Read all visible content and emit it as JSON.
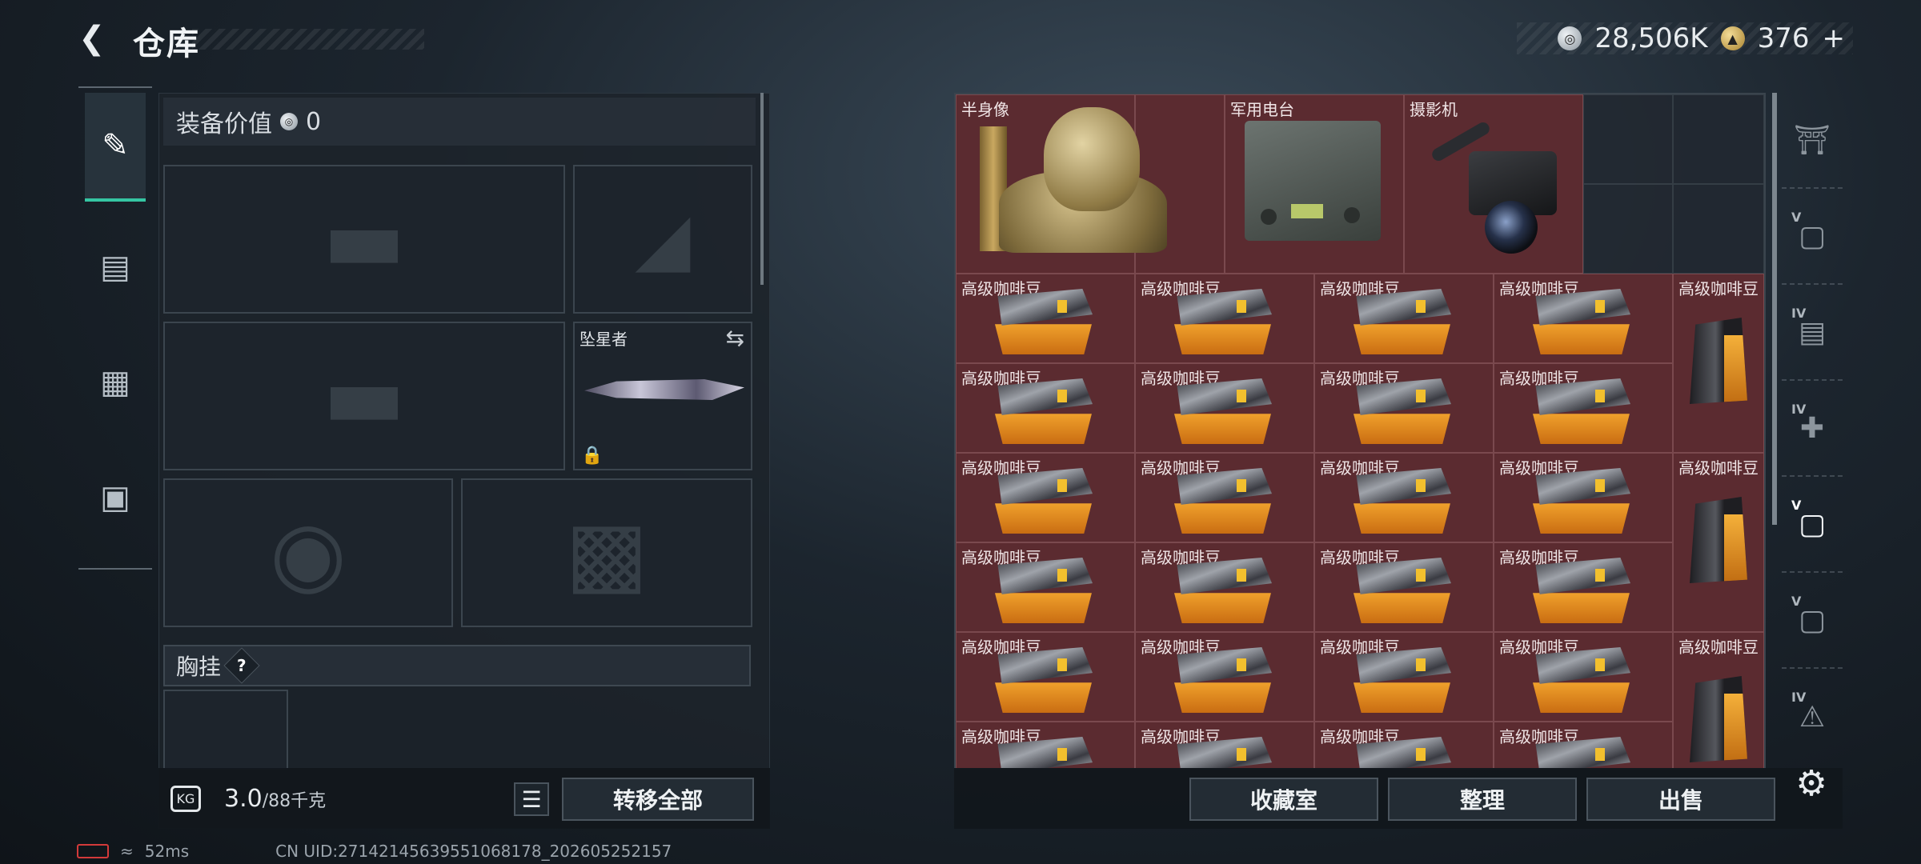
{
  "header": {
    "title": "仓库",
    "back_icon": "back-arrow-icon"
  },
  "currency": {
    "silver_value": "28,506K",
    "gold_value": "376",
    "gold_add": "+"
  },
  "loadout": {
    "value_label": "装备价值",
    "value_amount": "0",
    "melee_name": "坠星者",
    "chest_label": "胸挂",
    "help_glyph": "?",
    "weight_current": "3.0",
    "weight_max": "/88千克",
    "weight_icon_text": "KG",
    "transfer_all": "转移全部"
  },
  "side_tabs": [
    {
      "name": "weapons",
      "icon": "pistol-icon"
    },
    {
      "name": "backpack",
      "icon": "backpack-icon"
    },
    {
      "name": "vest",
      "icon": "vest-icon"
    },
    {
      "name": "toolbox",
      "icon": "briefcase-icon"
    }
  ],
  "storage": {
    "top_items": [
      {
        "label": "半身像"
      },
      {
        "label": "军用电台"
      },
      {
        "label": "摄影机"
      }
    ],
    "coffee_label": "高级咖啡豆"
  },
  "category_tabs": [
    {
      "icon": "safe-house-icon",
      "level": ""
    },
    {
      "icon": "camera-workbench-icon",
      "level": "V"
    },
    {
      "icon": "folder-icon",
      "level": "IV"
    },
    {
      "icon": "medical-bench-icon",
      "level": "IV"
    },
    {
      "icon": "camera-workbench-icon",
      "level": "V"
    },
    {
      "icon": "camera-workbench-icon",
      "level": "V"
    },
    {
      "icon": "warning-bench-icon",
      "level": "IV"
    }
  ],
  "bottom_buttons": {
    "collection": "收藏室",
    "sort": "整理",
    "sell": "出售"
  },
  "status": {
    "ping": "52ms",
    "uid": "CN UID:27142145639551068178_202605252157"
  },
  "colors": {
    "accent": "#35c6a3",
    "item_bg": "#5b2b30",
    "battery_low": "#d33a3a"
  }
}
